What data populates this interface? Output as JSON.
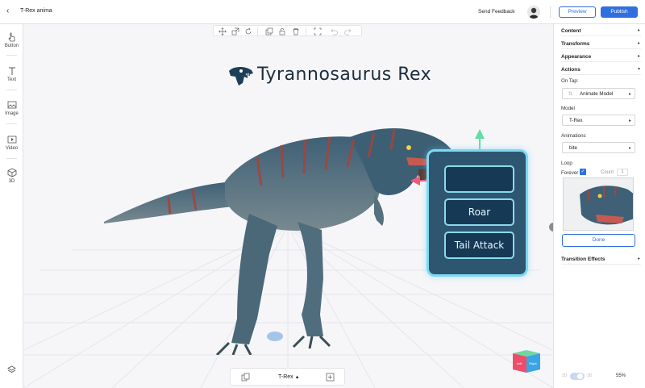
{
  "header": {
    "project_title": "T-Rex anima",
    "send_feedback": "Send Feedback",
    "preview_label": "Preview",
    "publish_label": "Publish"
  },
  "left_sidebar": {
    "tools": [
      {
        "label": "Button",
        "icon": "pointer-icon"
      },
      {
        "label": "Text",
        "icon": "text-icon"
      },
      {
        "label": "Image",
        "icon": "image-icon"
      },
      {
        "label": "Video",
        "icon": "video-icon"
      },
      {
        "label": "3D",
        "icon": "cube-icon"
      }
    ]
  },
  "canvas": {
    "scene_title": "Tyrannosaurus Rex",
    "panel_buttons": [
      "",
      "Roar",
      "Tail Attack"
    ],
    "model_selector": "T-Rex",
    "view_cube": {
      "left": "Left",
      "right": "Right"
    }
  },
  "right_panel": {
    "sections": [
      "Content",
      "Transforms",
      "Appearance",
      "Actions"
    ],
    "on_tap_label": "On Tap:",
    "on_tap_value": "Animate Model",
    "model_label": "Model",
    "model_value": "T-Rex",
    "animations_label": "Animations",
    "animations_value": "bite",
    "loop_label": "Loop",
    "forever_label": "Forever",
    "count_label": "Count",
    "count_value": "1",
    "done_label": "Done",
    "transition_label": "Transition Effects",
    "toggle_2d": "2D",
    "toggle_3d": "3D",
    "zoom": "55%"
  },
  "colors": {
    "accent": "#2f6fe0",
    "panel_fill": "#2f5670",
    "panel_glow": "#7fd8f2"
  }
}
